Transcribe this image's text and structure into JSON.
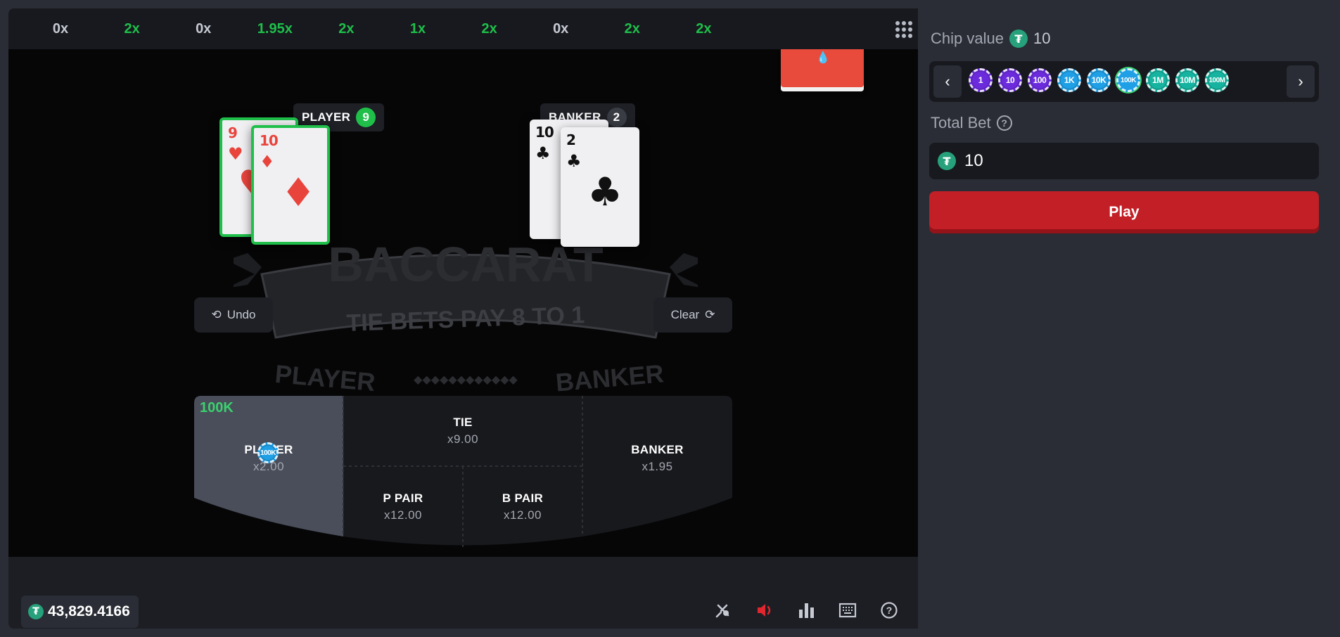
{
  "colors": {
    "win": "#1fbf4a",
    "loss_text": "#c7cad3",
    "tether": "#26a17b",
    "play": "#c21f27",
    "chip_purple": "#6b2bdc",
    "chip_blue": "#1e9fe6",
    "chip_teal": "#16b4a0"
  },
  "history": [
    {
      "label": "0x",
      "win": false
    },
    {
      "label": "2x",
      "win": true
    },
    {
      "label": "0x",
      "win": false
    },
    {
      "label": "1.95x",
      "win": true
    },
    {
      "label": "2x",
      "win": true
    },
    {
      "label": "1x",
      "win": true
    },
    {
      "label": "2x",
      "win": true
    },
    {
      "label": "0x",
      "win": false
    },
    {
      "label": "2x",
      "win": true
    },
    {
      "label": "2x",
      "win": true
    }
  ],
  "history_menu_icon": "grid-dots-icon",
  "player": {
    "label": "PLAYER",
    "score": "9",
    "cards": [
      {
        "rank": "9",
        "suit": "♥",
        "color": "red"
      },
      {
        "rank": "10",
        "suit": "♦",
        "color": "red"
      }
    ]
  },
  "banker": {
    "label": "BANKER",
    "score": "2",
    "cards": [
      {
        "rank": "10",
        "suit": "♣",
        "color": "black"
      },
      {
        "rank": "2",
        "suit": "♣",
        "color": "black"
      }
    ]
  },
  "logo": {
    "title": "BACCARAT",
    "banner": "TIE BETS PAY 8 TO 1",
    "left": "PLAYER",
    "right": "BANKER",
    "diamonds": "◆◆◆◆◆◆◆◆◆◆◆◆"
  },
  "controls": {
    "undo": "Undo",
    "clear": "Clear"
  },
  "bets": {
    "player": {
      "label": "PLAYER",
      "odds": "x2.00",
      "placed": "100K",
      "chip": "100K"
    },
    "tie": {
      "label": "TIE",
      "odds": "x9.00"
    },
    "banker": {
      "label": "BANKER",
      "odds": "x1.95"
    },
    "p_pair": {
      "label": "P PAIR",
      "odds": "x12.00"
    },
    "b_pair": {
      "label": "B PAIR",
      "odds": "x12.00"
    }
  },
  "balance": {
    "currency_icon": "tether-icon",
    "amount": "43,829.4166"
  },
  "toolbar": [
    "hotkeys-off-icon",
    "volume-icon",
    "stats-icon",
    "keyboard-icon",
    "help-icon"
  ],
  "panel": {
    "chip_value_label": "Chip value",
    "chip_value": "10",
    "chips": [
      {
        "label": "1",
        "color": "#6b2bdc",
        "selected": false
      },
      {
        "label": "10",
        "color": "#6b2bdc",
        "selected": false
      },
      {
        "label": "100",
        "color": "#6b2bdc",
        "selected": false
      },
      {
        "label": "1K",
        "color": "#1e9fe6",
        "selected": false
      },
      {
        "label": "10K",
        "color": "#1e9fe6",
        "selected": false
      },
      {
        "label": "100K",
        "color": "#1e9fe6",
        "selected": true
      },
      {
        "label": "1M",
        "color": "#16b4a0",
        "selected": false
      },
      {
        "label": "10M",
        "color": "#16b4a0",
        "selected": false
      },
      {
        "label": "100M",
        "color": "#16b4a0",
        "selected": false
      }
    ],
    "prev": "‹",
    "next": "›",
    "total_bet_label": "Total Bet",
    "total_bet": "10",
    "play": "Play"
  }
}
